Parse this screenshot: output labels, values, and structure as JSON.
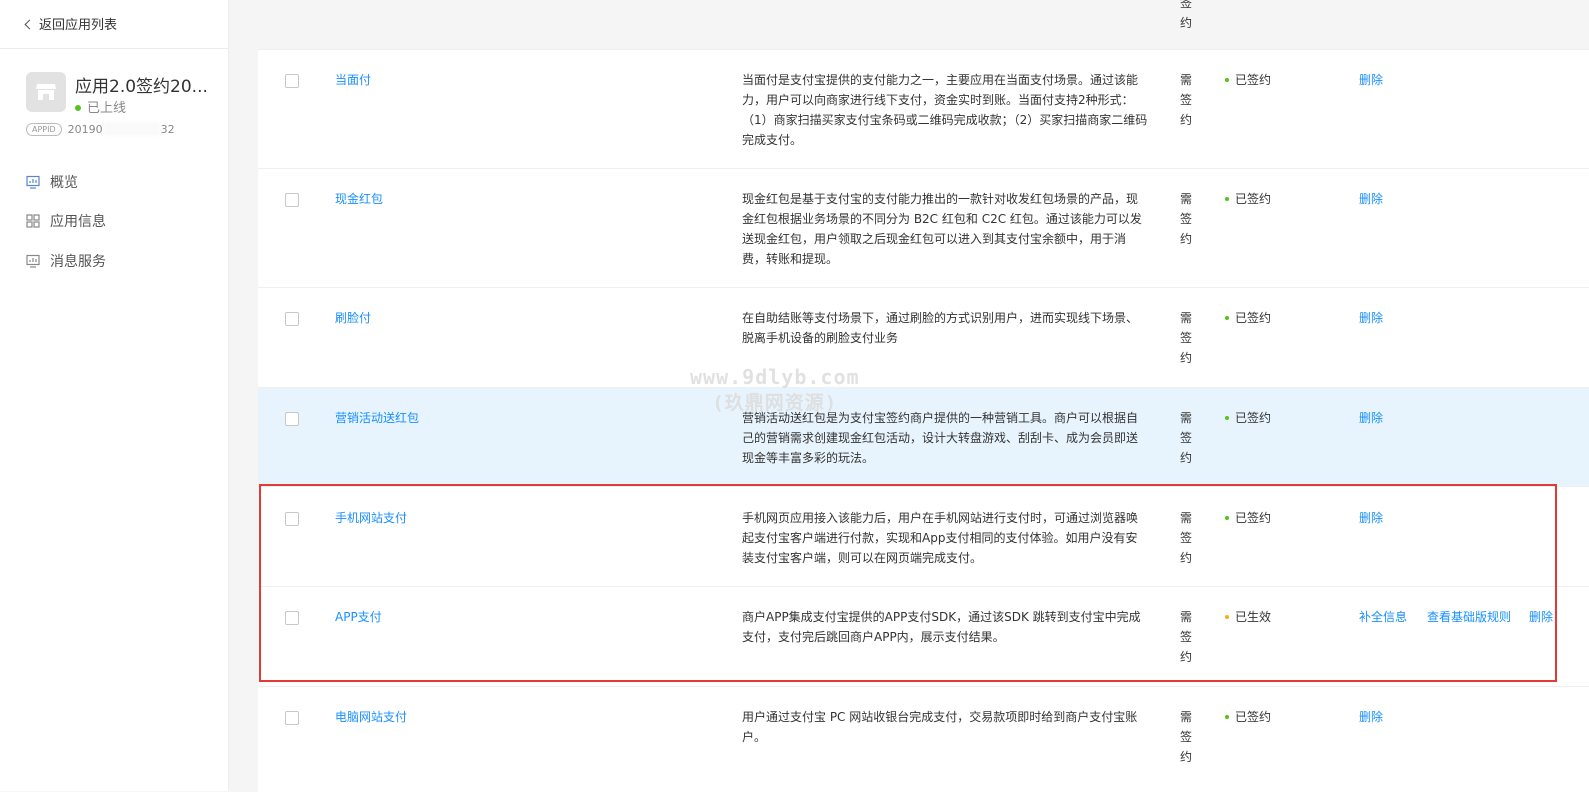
{
  "sidebar": {
    "back_label": "返回应用列表",
    "app_name": "应用2.0签约20...",
    "app_status": "已上线",
    "appid_tag": "APPID",
    "appid_prefix": "20190",
    "appid_suffix": "32",
    "nav": [
      {
        "label": "概览",
        "icon": "overview-icon"
      },
      {
        "label": "应用信息",
        "icon": "app-info-icon"
      },
      {
        "label": "消息服务",
        "icon": "message-service-icon"
      }
    ]
  },
  "table": {
    "top_partial_need": "签\n约",
    "rows": [
      {
        "name": "当面付",
        "desc": "当面付是支付宝提供的支付能力之一，主要应用在当面支付场景。通过该能力，用户可以向商家进行线下支付，资金实时到账。当面付支持2种形式：（1）商家扫描买家支付宝条码或二维码完成收款；（2）买家扫描商家二维码完成支付。",
        "need": "需签约",
        "status": "已签约",
        "actions": [
          "删除"
        ]
      },
      {
        "name": "现金红包",
        "desc": "现金红包是基于支付宝的支付能力推出的一款针对收发红包场景的产品，现金红包根据业务场景的不同分为 B2C 红包和 C2C 红包。通过该能力可以发送现金红包，用户领取之后现金红包可以进入到其支付宝余额中，用于消费，转账和提现。",
        "need": "需签约",
        "status": "已签约",
        "actions": [
          "删除"
        ]
      },
      {
        "name": "刷脸付",
        "desc": "在自助结账等支付场景下，通过刷脸的方式识别用户，进而实现线下场景、脱离手机设备的刷脸支付业务",
        "need": "需签约",
        "status": "已签约",
        "actions": [
          "删除"
        ]
      },
      {
        "name": "营销活动送红包",
        "desc": "营销活动送红包是为支付宝签约商户提供的一种营销工具。商户可以根据自己的营销需求创建现金红包活动，设计大转盘游戏、刮刮卡、成为会员即送现金等丰富多彩的玩法。",
        "need": "需签约",
        "status": "已签约",
        "actions": [
          "删除"
        ]
      },
      {
        "name": "手机网站支付",
        "desc": "手机网页应用接入该能力后，用户在手机网站进行支付时，可通过浏览器唤起支付宝客户端进行付款，实现和App支付相同的支付体验。如用户没有安装支付宝客户端，则可以在网页端完成支付。",
        "need": "需签约",
        "status": "已签约",
        "actions": [
          "删除"
        ]
      },
      {
        "name": "APP支付",
        "desc": "商户APP集成支付宝提供的APP支付SDK，通过该SDK 跳转到支付宝中完成支付，支付完后跳回商户APP内，展示支付结果。",
        "need": "需签约",
        "status": "已生效",
        "actions": [
          "补全信息",
          "查看基础版规则",
          "删除"
        ]
      },
      {
        "name": "电脑网站支付",
        "desc": "用户通过支付宝 PC 网站收银台完成支付，交易款项即时给到商户支付宝账户。",
        "need": "需签约",
        "status": "已签约",
        "actions": [
          "删除"
        ]
      }
    ]
  },
  "watermark": {
    "line1": "www.9dlyb.com",
    "line2": "(玖鼎网资源)"
  },
  "colors": {
    "link": "#1890ff",
    "signed_dot": "#52c41a",
    "effective_dot": "#faad14",
    "highlight_row": "#e8f4fd",
    "annotation_box": "#e53935"
  }
}
